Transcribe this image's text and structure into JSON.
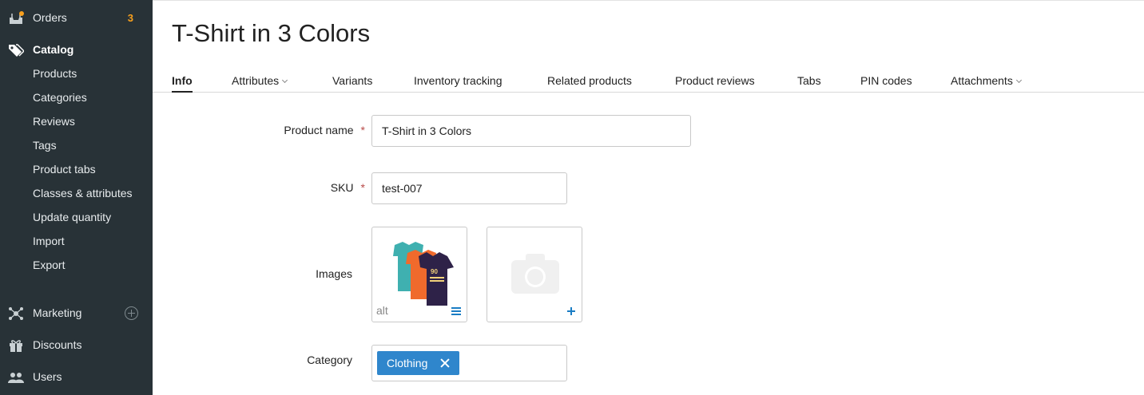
{
  "sidebar": {
    "orders": {
      "label": "Orders",
      "badge": "3"
    },
    "catalog": {
      "label": "Catalog",
      "items": [
        "Products",
        "Categories",
        "Reviews",
        "Tags",
        "Product tabs",
        "Classes & attributes",
        "Update quantity",
        "Import",
        "Export"
      ]
    },
    "marketing": {
      "label": "Marketing"
    },
    "discounts": {
      "label": "Discounts"
    },
    "users": {
      "label": "Users"
    }
  },
  "page": {
    "title": "T-Shirt in 3 Colors"
  },
  "tabs": [
    {
      "label": "Info",
      "active": true
    },
    {
      "label": "Attributes"
    },
    {
      "label": "Variants"
    },
    {
      "label": "Inventory tracking"
    },
    {
      "label": "Related products"
    },
    {
      "label": "Product reviews"
    },
    {
      "label": "Tabs"
    },
    {
      "label": "PIN codes"
    },
    {
      "label": "Attachments"
    }
  ],
  "form": {
    "product_name": {
      "label": "Product name",
      "required_mark": "*",
      "value": "T-Shirt in 3 Colors"
    },
    "sku": {
      "label": "SKU",
      "required_mark": "*",
      "value": "test-007"
    },
    "images": {
      "label": "Images",
      "alt": "alt"
    },
    "category": {
      "label": "Category",
      "tag": "Clothing"
    }
  },
  "colors": {
    "sidebar_bg": "#283237",
    "badge": "#f8a01d",
    "accent_blue": "#2f86cc",
    "required": "#b94a48"
  }
}
